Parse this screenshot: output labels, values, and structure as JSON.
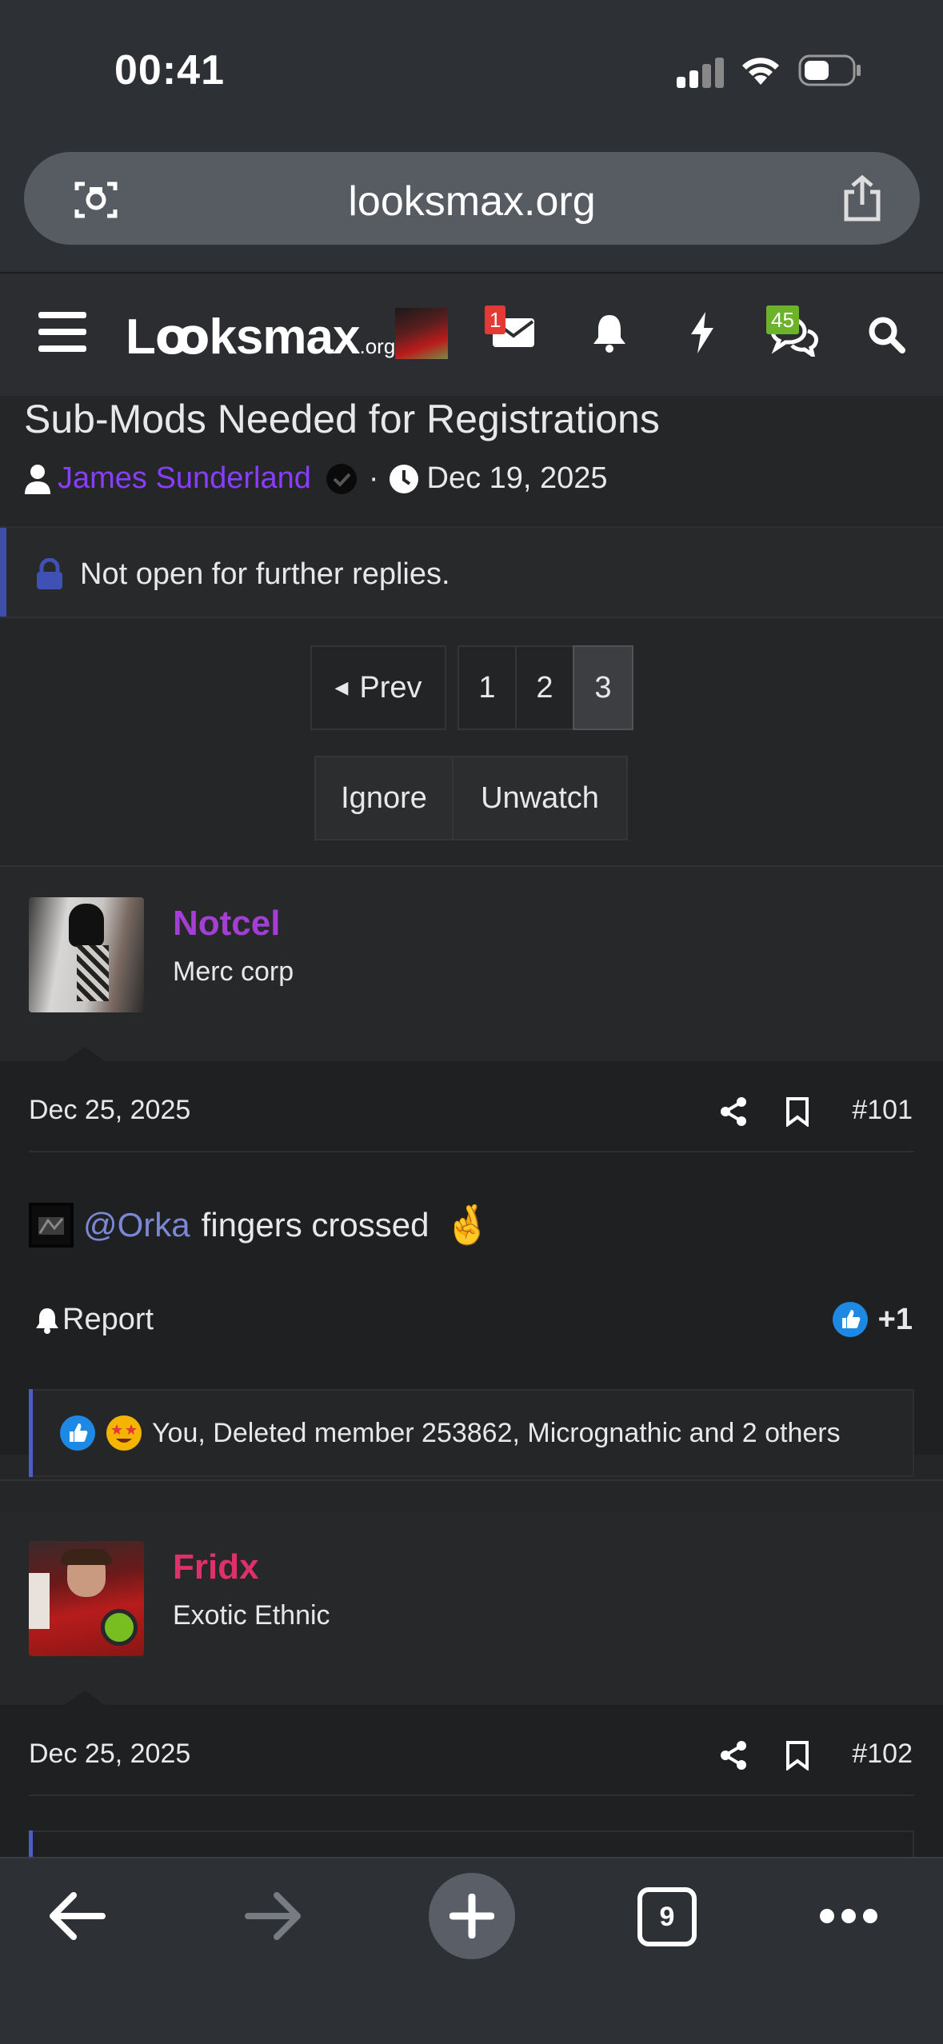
{
  "status_bar": {
    "time": "00:41"
  },
  "browser": {
    "url": "looksmax.org",
    "tab_count": "9"
  },
  "nav": {
    "logo_main": "Lꝏksmax",
    "logo_suffix": ".org",
    "inbox_badge": "1",
    "chat_badge": "45"
  },
  "thread": {
    "title": "Sub-Mods Needed for Registrations",
    "author": "James Sunderland",
    "separator": "·",
    "date": "Dec 19, 2025",
    "notice": "Not open for further replies."
  },
  "pagination": {
    "prev_label": "Prev",
    "pages": [
      "1",
      "2",
      "3"
    ],
    "current": "3"
  },
  "actions": {
    "ignore": "Ignore",
    "unwatch": "Unwatch"
  },
  "posts": [
    {
      "username": "Notcel",
      "user_title": "Merc corp",
      "username_color": "#a43fd6",
      "date": "Dec 25, 2025",
      "number": "#101",
      "mention": "@Orka",
      "body": "fingers crossed",
      "emoji": "🤞",
      "report_label": "Report",
      "like_count": "+1",
      "reactions_text": "You, Deleted member 253862, Micrognathic and 2 others"
    },
    {
      "username": "Fridx",
      "user_title": "Exotic Ethnic",
      "username_color": "#e0306a",
      "date": "Dec 25, 2025",
      "number": "#102"
    }
  ],
  "colors": {
    "accent_blue": "#4c5ec1",
    "author_purple": "#8b3dff",
    "online_green": "#78be20"
  }
}
